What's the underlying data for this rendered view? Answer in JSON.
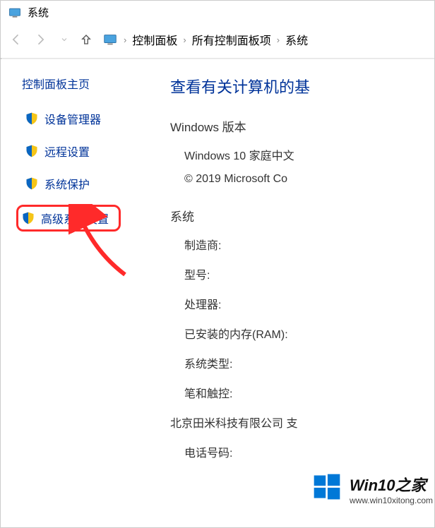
{
  "titlebar": {
    "title": "系统"
  },
  "breadcrumb": {
    "items": [
      "控制面板",
      "所有控制面板项",
      "系统"
    ]
  },
  "sidebar": {
    "title": "控制面板主页",
    "items": [
      {
        "label": "设备管理器"
      },
      {
        "label": "远程设置"
      },
      {
        "label": "系统保护"
      },
      {
        "label": "高级系统设置"
      }
    ]
  },
  "main": {
    "heading": "查看有关计算机的基",
    "windows_section": {
      "title": "Windows 版本",
      "edition": "Windows 10 家庭中文",
      "copyright": "© 2019 Microsoft Co"
    },
    "system_section": {
      "title": "系统",
      "rows": {
        "manufacturer": "制造商:",
        "model": "型号:",
        "processor": "处理器:",
        "ram": "已安装的内存(RAM):",
        "systype": "系统类型:",
        "pentouch": "笔和触控:"
      },
      "support": "北京田米科技有限公司 支",
      "phone": "电话号码:"
    }
  },
  "watermark": {
    "title": "Win10之家",
    "sub": "www.win10xitong.com"
  }
}
